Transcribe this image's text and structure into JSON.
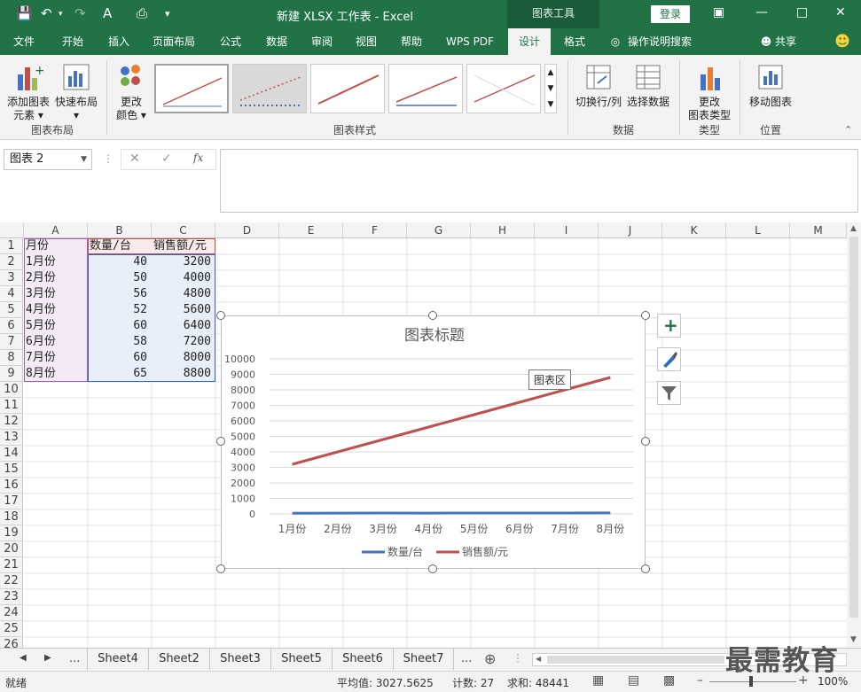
{
  "title": {
    "text": "新建 XLSX 工作表  -  Excel",
    "context_tab": "图表工具",
    "login": "登录"
  },
  "tabs": [
    "文件",
    "开始",
    "插入",
    "页面布局",
    "公式",
    "数据",
    "审阅",
    "视图",
    "帮助",
    "WPS PDF",
    "设计",
    "格式"
  ],
  "tell_me": "操作说明搜索",
  "share": "共享",
  "ribbon": {
    "add_element": "添加图表元素",
    "add_element_l1": "添加图表",
    "add_element_l2": "元素",
    "quick_layout": "快速布局",
    "change_color_l1": "更改",
    "change_color_l2": "颜色",
    "group_layout": "图表布局",
    "group_styles": "图表样式",
    "switch": "切换行/列",
    "select_data": "选择数据",
    "group_data": "数据",
    "change_type_l1": "更改",
    "change_type_l2": "图表类型",
    "group_type": "类型",
    "move_chart": "移动图表",
    "group_location": "位置"
  },
  "formula": {
    "namebox": "图表 2",
    "fx": "fx"
  },
  "columns": [
    "A",
    "B",
    "C",
    "D",
    "E",
    "F",
    "G",
    "H",
    "I",
    "J",
    "K",
    "L",
    "M"
  ],
  "rows": [
    "1",
    "2",
    "3",
    "4",
    "5",
    "6",
    "7",
    "8",
    "9",
    "10",
    "11",
    "12",
    "13",
    "14",
    "15",
    "16",
    "17",
    "18",
    "19",
    "20",
    "21",
    "22",
    "23",
    "24",
    "25",
    "26"
  ],
  "table": {
    "headers": [
      "月份",
      "数量/台",
      "销售额/元"
    ],
    "data": [
      [
        "1月份",
        "40",
        "3200"
      ],
      [
        "2月份",
        "50",
        "4000"
      ],
      [
        "3月份",
        "56",
        "4800"
      ],
      [
        "4月份",
        "52",
        "5600"
      ],
      [
        "5月份",
        "60",
        "6400"
      ],
      [
        "6月份",
        "58",
        "7200"
      ],
      [
        "7月份",
        "60",
        "8000"
      ],
      [
        "8月份",
        "65",
        "8800"
      ]
    ]
  },
  "chart_data": {
    "type": "line",
    "title": "图表标题",
    "categories": [
      "1月份",
      "2月份",
      "3月份",
      "4月份",
      "5月份",
      "6月份",
      "7月份",
      "8月份"
    ],
    "series": [
      {
        "name": "数量/台",
        "values": [
          40,
          50,
          56,
          52,
          60,
          58,
          60,
          65
        ],
        "color": "#4472c4"
      },
      {
        "name": "销售额/元",
        "values": [
          3200,
          4000,
          4800,
          5600,
          6400,
          7200,
          8000,
          8800
        ],
        "color": "#c0504d"
      }
    ],
    "ylim": [
      0,
      10000
    ],
    "yticks": [
      "0",
      "1000",
      "2000",
      "3000",
      "4000",
      "5000",
      "6000",
      "7000",
      "8000",
      "9000",
      "10000"
    ],
    "grid": true,
    "legend": "bottom",
    "tooltip": "图表区"
  },
  "sheets": [
    "Sheet4",
    "Sheet2",
    "Sheet3",
    "Sheet5",
    "Sheet6",
    "Sheet7"
  ],
  "sheet_nav": {
    "more_left": "...",
    "more_right": "..."
  },
  "status": {
    "ready": "就绪",
    "average": "平均值: 3027.5625",
    "count": "计数: 27",
    "sum": "求和: 48441",
    "zoom": "100%"
  },
  "watermark": "最需教育",
  "colors": {
    "accent": "#217346"
  }
}
